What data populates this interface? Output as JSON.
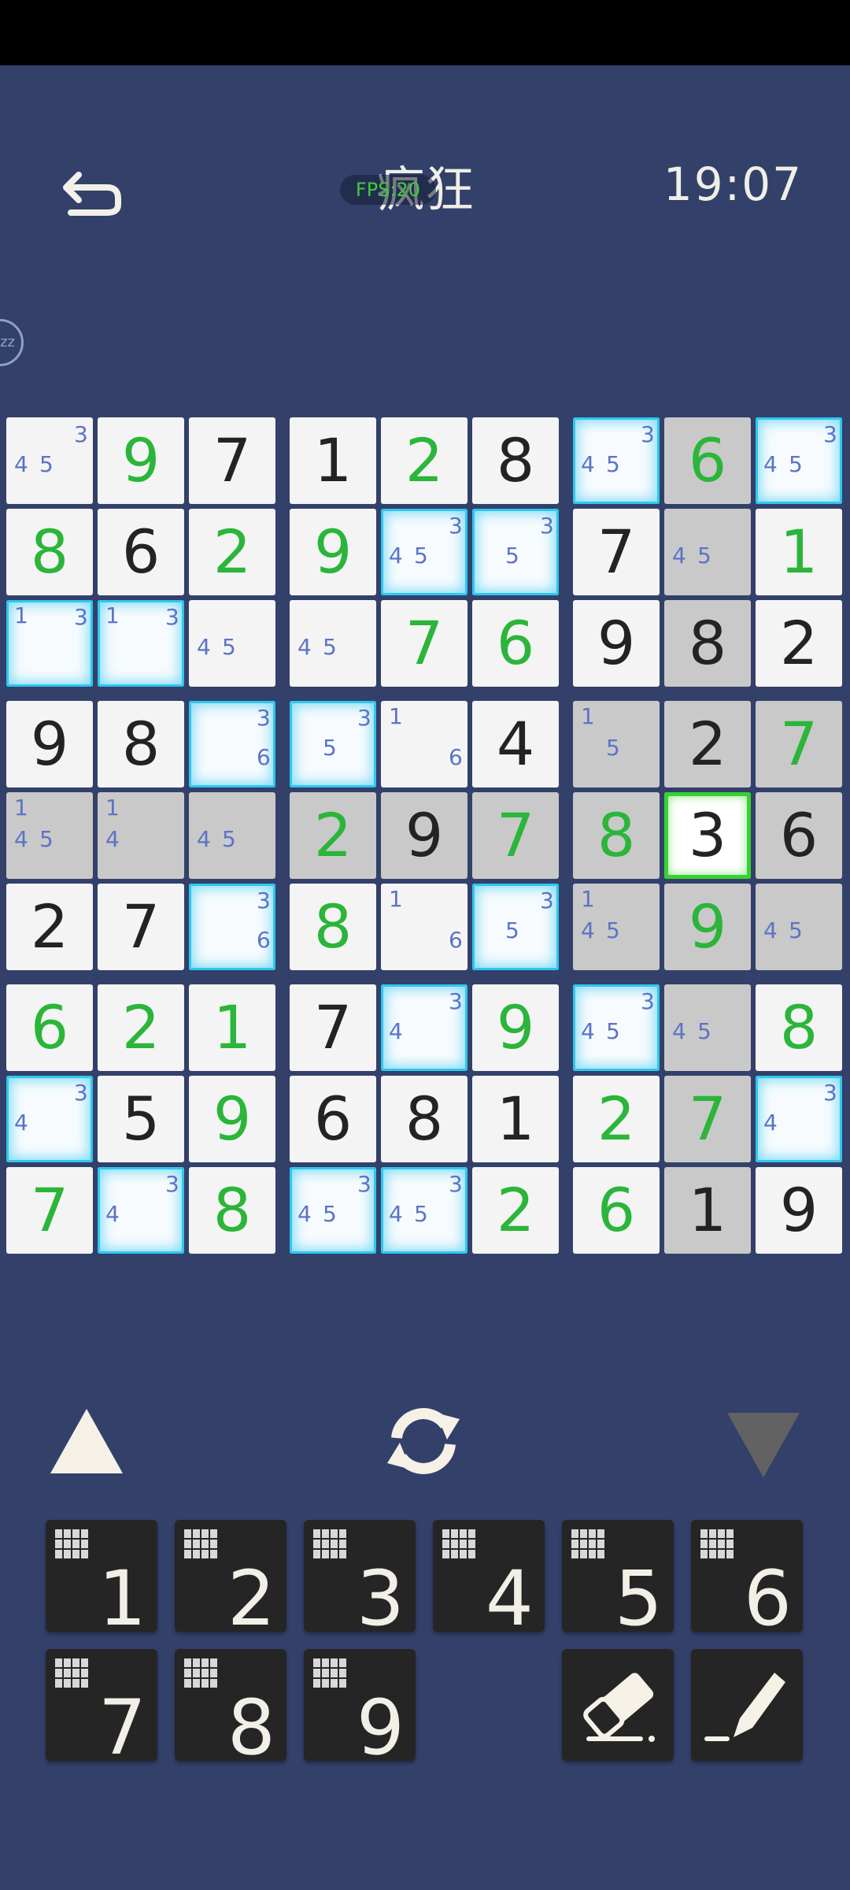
{
  "header": {
    "title": "疯狂",
    "fps_label": "FPS:20",
    "timer": "19:07",
    "pause_label": "zz"
  },
  "grid": [
    [
      {
        "v": 0,
        "n": [
          4,
          5,
          3
        ]
      },
      {
        "v": 9,
        "u": 1
      },
      {
        "v": 7
      },
      {
        "v": 1
      },
      {
        "v": 2,
        "u": 1
      },
      {
        "v": 8
      },
      {
        "v": 0,
        "n": [
          4,
          5,
          3
        ]
      },
      {
        "v": 6,
        "u": 1
      },
      {
        "v": 0,
        "n": [
          4,
          5,
          3
        ]
      }
    ],
    [
      {
        "v": 8,
        "u": 1
      },
      {
        "v": 6
      },
      {
        "v": 2,
        "u": 1
      },
      {
        "v": 9,
        "u": 1
      },
      {
        "v": 0,
        "n": [
          4,
          5,
          3
        ]
      },
      {
        "v": 0,
        "n": [
          5,
          3
        ]
      },
      {
        "v": 7
      },
      {
        "v": 0,
        "n": [
          4,
          5
        ]
      },
      {
        "v": 1,
        "u": 1
      }
    ],
    [
      {
        "v": 0,
        "n": [
          1,
          3
        ]
      },
      {
        "v": 0,
        "n": [
          1,
          3
        ]
      },
      {
        "v": 0,
        "n": [
          4,
          5
        ]
      },
      {
        "v": 0,
        "n": [
          4,
          5
        ]
      },
      {
        "v": 7,
        "u": 1
      },
      {
        "v": 6,
        "u": 1
      },
      {
        "v": 9
      },
      {
        "v": 8
      },
      {
        "v": 2
      }
    ],
    [
      {
        "v": 9
      },
      {
        "v": 8
      },
      {
        "v": 0,
        "n": [
          3,
          6
        ]
      },
      {
        "v": 0,
        "n": [
          5,
          3
        ]
      },
      {
        "v": 0,
        "n": [
          1,
          6
        ]
      },
      {
        "v": 4
      },
      {
        "v": 0,
        "n": [
          1,
          5
        ]
      },
      {
        "v": 2
      },
      {
        "v": 7,
        "u": 1
      }
    ],
    [
      {
        "v": 0,
        "n": [
          1,
          4,
          5
        ]
      },
      {
        "v": 0,
        "n": [
          1,
          4
        ]
      },
      {
        "v": 0,
        "n": [
          4,
          5
        ]
      },
      {
        "v": 2,
        "u": 1
      },
      {
        "v": 9
      },
      {
        "v": 7,
        "u": 1
      },
      {
        "v": 8,
        "u": 1
      },
      {
        "v": 3
      },
      {
        "v": 6
      }
    ],
    [
      {
        "v": 2
      },
      {
        "v": 7
      },
      {
        "v": 0,
        "n": [
          3,
          6
        ]
      },
      {
        "v": 8,
        "u": 1
      },
      {
        "v": 0,
        "n": [
          1,
          6
        ]
      },
      {
        "v": 0,
        "n": [
          5,
          3
        ]
      },
      {
        "v": 0,
        "n": [
          1,
          4,
          5
        ]
      },
      {
        "v": 9,
        "u": 1
      },
      {
        "v": 0,
        "n": [
          4,
          5
        ]
      }
    ],
    [
      {
        "v": 6,
        "u": 1
      },
      {
        "v": 2,
        "u": 1
      },
      {
        "v": 1,
        "u": 1
      },
      {
        "v": 7
      },
      {
        "v": 0,
        "n": [
          4,
          3
        ]
      },
      {
        "v": 9,
        "u": 1
      },
      {
        "v": 0,
        "n": [
          4,
          5,
          3
        ]
      },
      {
        "v": 0,
        "n": [
          4,
          5
        ]
      },
      {
        "v": 8,
        "u": 1
      }
    ],
    [
      {
        "v": 0,
        "n": [
          4,
          3
        ]
      },
      {
        "v": 5
      },
      {
        "v": 9,
        "u": 1
      },
      {
        "v": 6
      },
      {
        "v": 8
      },
      {
        "v": 1
      },
      {
        "v": 2,
        "u": 1
      },
      {
        "v": 7,
        "u": 1
      },
      {
        "v": 0,
        "n": [
          4,
          3
        ]
      }
    ],
    [
      {
        "v": 7,
        "u": 1
      },
      {
        "v": 0,
        "n": [
          4,
          3
        ]
      },
      {
        "v": 8,
        "u": 1
      },
      {
        "v": 0,
        "n": [
          4,
          5,
          3
        ]
      },
      {
        "v": 0,
        "n": [
          4,
          5,
          3
        ]
      },
      {
        "v": 2,
        "u": 1
      },
      {
        "v": 6,
        "u": 1
      },
      {
        "v": 1
      },
      {
        "v": 9
      }
    ]
  ],
  "selected": {
    "row": 4,
    "col": 7,
    "value": 3
  },
  "gray_cells": [
    [
      0,
      7
    ],
    [
      1,
      7
    ],
    [
      2,
      7
    ],
    [
      3,
      6
    ],
    [
      3,
      7
    ],
    [
      3,
      8
    ],
    [
      4,
      0
    ],
    [
      4,
      1
    ],
    [
      4,
      2
    ],
    [
      4,
      3
    ],
    [
      4,
      4
    ],
    [
      4,
      5
    ],
    [
      4,
      6
    ],
    [
      4,
      8
    ],
    [
      5,
      6
    ],
    [
      5,
      7
    ],
    [
      5,
      8
    ],
    [
      6,
      7
    ],
    [
      7,
      7
    ],
    [
      8,
      7
    ]
  ],
  "candidate_highlight_cells": [
    [
      0,
      6
    ],
    [
      0,
      8
    ],
    [
      1,
      4
    ],
    [
      1,
      5
    ],
    [
      2,
      0
    ],
    [
      2,
      1
    ],
    [
      3,
      2
    ],
    [
      3,
      3
    ],
    [
      5,
      2
    ],
    [
      5,
      5
    ],
    [
      6,
      4
    ],
    [
      6,
      6
    ],
    [
      7,
      0
    ],
    [
      7,
      8
    ],
    [
      8,
      1
    ],
    [
      8,
      3
    ],
    [
      8,
      4
    ]
  ],
  "numpad": [
    "1",
    "2",
    "3",
    "4",
    "5",
    "6",
    "7",
    "8",
    "9"
  ],
  "controls": {
    "prev": "triangle-up-icon",
    "cycle": "refresh-icon",
    "next": "triangle-down-icon",
    "erase": "eraser-icon",
    "pencil": "pencil-icon"
  },
  "colors": {
    "background": "#33406a",
    "given_digit": "#232323",
    "user_digit": "#2bb53a",
    "note_digit": "#5b74c6",
    "highlight_gray": "#c9c9c9",
    "candidate_glow": "#2ec7ee",
    "cursor_green": "#39d12f"
  }
}
